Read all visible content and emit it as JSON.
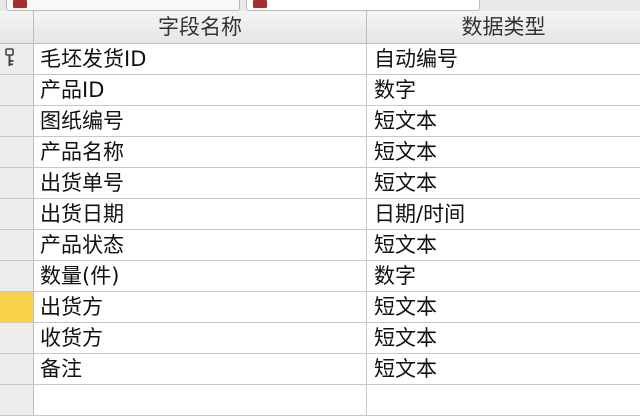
{
  "tabs": [
    {
      "label": ""
    },
    {
      "label": ""
    }
  ],
  "columns": {
    "name": "字段名称",
    "type": "数据类型"
  },
  "rows": [
    {
      "name": "毛坯发货ID",
      "type": "自动编号",
      "primary_key": true,
      "selected": false
    },
    {
      "name": "产品ID",
      "type": "数字",
      "primary_key": false,
      "selected": false
    },
    {
      "name": "图纸编号",
      "type": "短文本",
      "primary_key": false,
      "selected": false
    },
    {
      "name": "产品名称",
      "type": "短文本",
      "primary_key": false,
      "selected": false
    },
    {
      "name": "出货单号",
      "type": "短文本",
      "primary_key": false,
      "selected": false
    },
    {
      "name": "出货日期",
      "type": "日期/时间",
      "primary_key": false,
      "selected": false
    },
    {
      "name": "产品状态",
      "type": "短文本",
      "primary_key": false,
      "selected": false
    },
    {
      "name": "数量(件)",
      "type": "数字",
      "primary_key": false,
      "selected": false
    },
    {
      "name": "出货方",
      "type": "短文本",
      "primary_key": false,
      "selected": true
    },
    {
      "name": "收货方",
      "type": "短文本",
      "primary_key": false,
      "selected": false
    },
    {
      "name": "备注",
      "type": "短文本",
      "primary_key": false,
      "selected": false
    },
    {
      "name": "",
      "type": "",
      "primary_key": false,
      "selected": false
    }
  ],
  "colors": {
    "selected_row_selector": "#f9d14a",
    "grid_line": "#c8c8c8",
    "header_bg": "#ececec"
  }
}
